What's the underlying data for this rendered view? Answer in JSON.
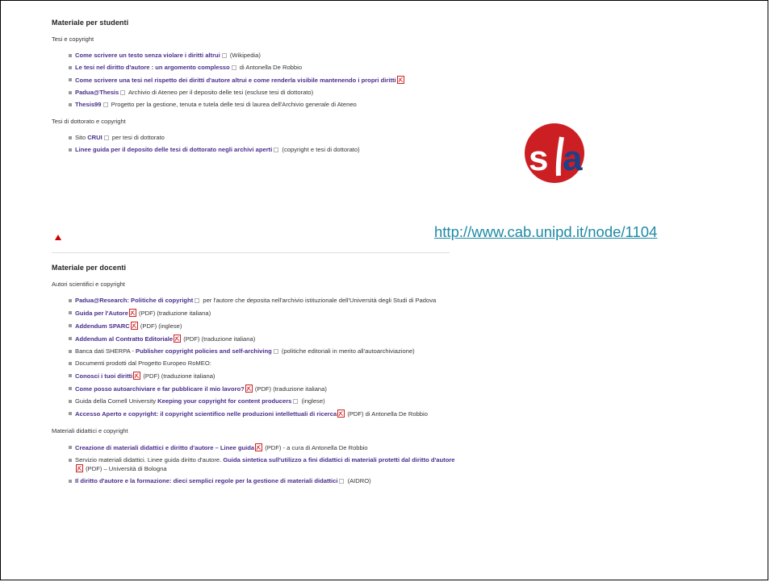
{
  "students": {
    "title": "Materiale per studenti",
    "groups": [
      {
        "subtitle": "Tesi e copyright",
        "items": [
          {
            "pre": "",
            "link": "Come scrivere un testo senza violare i diritti altrui",
            "ext": true,
            "pdf": false,
            "post": " (Wikipedia)"
          },
          {
            "pre": "",
            "link": "Le tesi nel diritto d'autore : un argomento complesso",
            "ext": true,
            "pdf": false,
            "post": " di Antonella De Robbio"
          },
          {
            "pre": "",
            "link": "Come scrivere una tesi nel rispetto dei diritti d'autore altrui e come renderla visibile mantenendo i propri diritti",
            "ext": false,
            "pdf": true,
            "post": ""
          },
          {
            "pre": "",
            "link": "Padua@Thesis",
            "ext": true,
            "pdf": false,
            "post": " Archivio di Ateneo per il deposito delle tesi (escluse tesi di dottorato)"
          },
          {
            "pre": "",
            "link": "Thesis99",
            "ext": true,
            "pdf": false,
            "post": " Progetto per la gestione, tenuta e tutela delle tesi di laurea dell'Archivio generale di Ateneo"
          }
        ]
      },
      {
        "subtitle": "Tesi di dottorato e copyright",
        "items": [
          {
            "pre": "Sito ",
            "link": "CRUI",
            "ext": true,
            "pdf": false,
            "post": " per tesi di dottorato"
          },
          {
            "pre": "",
            "link": "Linee guida per il deposito delle tesi di dottorato negli archivi aperti",
            "ext": true,
            "pdf": false,
            "post": " (copyright e tesi di dottorato)"
          }
        ]
      }
    ]
  },
  "teachers": {
    "title": "Materiale per docenti",
    "groups": [
      {
        "subtitle": "Autori scientifici e copyright",
        "items": [
          {
            "pre": "",
            "link": "Padua@Research: Politiche di copyright",
            "ext": true,
            "pdf": false,
            "post": " per l'autore che deposita nell'archivio istituzionale dell'Università degli Studi di Padova"
          },
          {
            "pre": "",
            "link": "Guida per l'Autore",
            "ext": false,
            "pdf": true,
            "post": " (PDF) (traduzione italiana)"
          },
          {
            "pre": "",
            "link": "Addendum SPARC",
            "ext": false,
            "pdf": true,
            "post": " (PDF) (inglese)"
          },
          {
            "pre": "",
            "link": "Addendum al Contratto Editoriale",
            "ext": false,
            "pdf": true,
            "post": " (PDF) (traduzione italiana)"
          },
          {
            "pre": "Banca dati SHERPA - ",
            "link": "Publisher copyright policies and self-archiving",
            "ext": true,
            "pdf": false,
            "post": " (politiche editoriali in merito all'autoarchiviazione)"
          },
          {
            "pre": "Documenti prodotti dal Progetto Europeo RoMEO:",
            "link": "",
            "ext": false,
            "pdf": false,
            "post": ""
          },
          {
            "pre": "",
            "link": "Conosci i tuoi diritti",
            "ext": false,
            "pdf": true,
            "post": " (PDF) (traduzione italiana)"
          },
          {
            "pre": "",
            "link": "Come posso autoarchiviare e far pubblicare il mio lavoro?",
            "ext": false,
            "pdf": true,
            "post": " (PDF) (traduzione italiana)"
          },
          {
            "pre": "Guida della Cornell University ",
            "link": "Keeping your copyright for content producers",
            "ext": true,
            "pdf": false,
            "post": " (inglese)"
          },
          {
            "pre": "",
            "link": "Accesso Aperto e copyright: il copyright scientifico nelle produzioni intellettuali di ricerca",
            "ext": false,
            "pdf": true,
            "post": " (PDF) di Antonella De Robbio"
          }
        ]
      },
      {
        "subtitle": "Materiali didattici e copyright",
        "items": [
          {
            "pre": "",
            "link": "Creazione di materiali didattici e diritto d'autore – Linee guida",
            "ext": false,
            "pdf": true,
            "post": " (PDF) - a cura di Antonella De Robbio"
          },
          {
            "pre": "Servizio materiali didattici. Linee guida diritto d'autore. ",
            "link": "Guida sintetica sull'utilizzo a fini didattici di materiali protetti dal diritto d'autore",
            "ext": false,
            "pdf": true,
            "post": " (PDF) – Università di Bologna"
          },
          {
            "pre": "",
            "link": "Il diritto d'autore e la formazione: dieci semplici regole per la gestione di materiali didattici",
            "ext": true,
            "pdf": false,
            "post": " (AIDRO)"
          }
        ]
      }
    ]
  },
  "logo": {
    "text": "sba",
    "color_red": "#cc1f24",
    "color_blue": "#1f3f86"
  },
  "source_link": "http://www.cab.unipd.it/node/1104",
  "colors": {
    "link": "#4a2d8c",
    "url": "#1f8aa4",
    "arrow": "#cc0000"
  },
  "icons": {
    "external": "external-link-icon",
    "pdf": "pdf-icon",
    "back_to_top": "triangle-up-icon"
  }
}
